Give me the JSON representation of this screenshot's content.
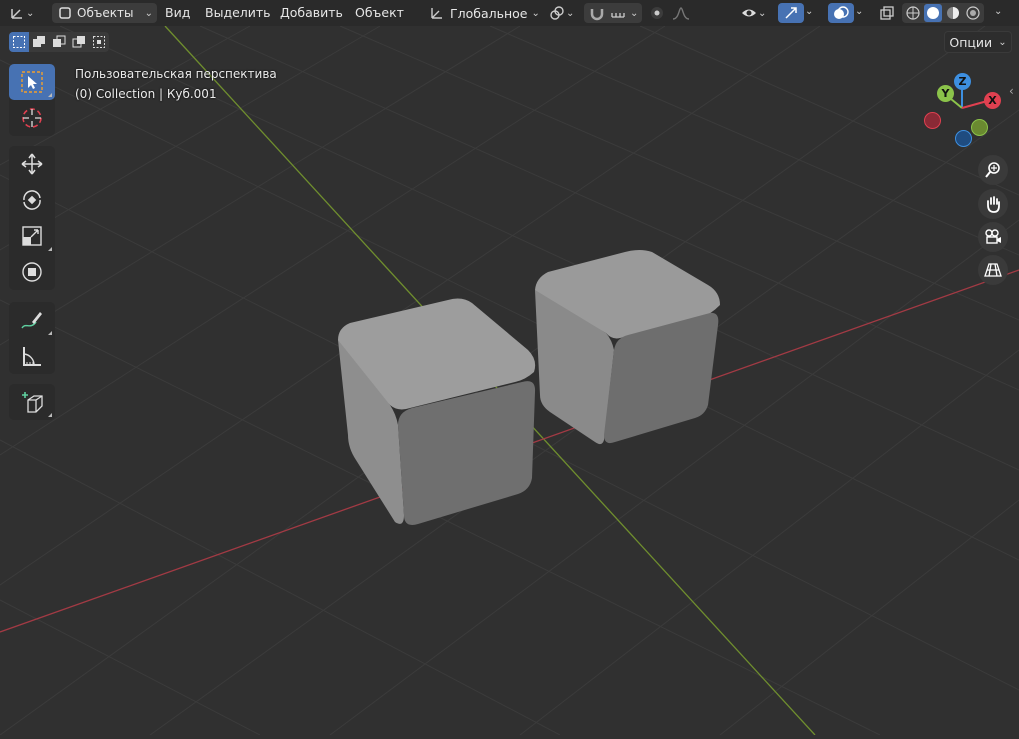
{
  "header": {
    "mode": "Объекты",
    "menus": [
      "Вид",
      "Выделить",
      "Добавить",
      "Объект"
    ],
    "orientation": "Глобальное"
  },
  "options_label": "Опции",
  "viewport": {
    "perspective_label": "Пользовательская перспектива",
    "collection_label": "(0) Collection | Куб.001"
  },
  "gizmo": {
    "z": "Z",
    "y": "Y",
    "x": "X"
  },
  "colors": {
    "accent": "#4772b3",
    "x_axis": "#e04050",
    "y_axis": "#8bc34a",
    "z_axis": "#3d8fe0",
    "grid_line": "#3a3a3a",
    "x_line": "#a23a44",
    "y_line": "#6f8e2e"
  },
  "tools": [
    "select-box",
    "cursor",
    "move",
    "rotate",
    "scale",
    "transform",
    "annotate",
    "measure",
    "add-cube"
  ]
}
